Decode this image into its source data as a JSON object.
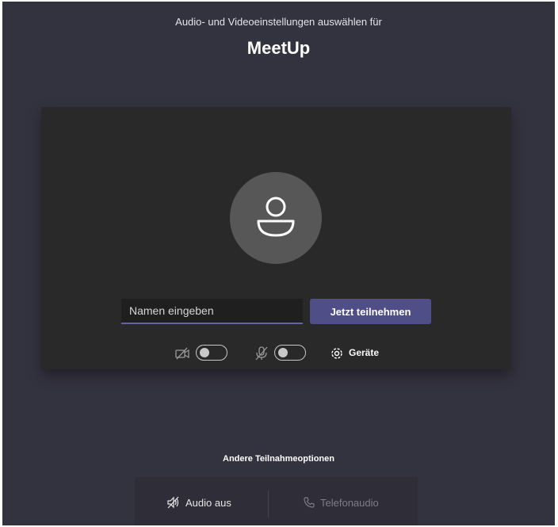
{
  "header": {
    "subtitle": "Audio- und Videoeinstellungen auswählen für",
    "title": "MeetUp"
  },
  "preview": {
    "avatar_icon": "person-icon",
    "name_placeholder": "Namen eingeben",
    "join_label": "Jetzt teilnehmen",
    "camera": {
      "icon": "camera-off-icon",
      "on": false
    },
    "microphone": {
      "icon": "mic-off-icon",
      "on": false
    },
    "devices_label": "Geräte",
    "devices_icon": "gear-icon"
  },
  "other_options": {
    "title": "Andere Teilnahmeoptionen",
    "audio_off_label": "Audio aus",
    "audio_off_icon": "speaker-off-icon",
    "phone_audio_label": "Telefonaudio",
    "phone_audio_icon": "phone-icon"
  },
  "colors": {
    "background": "#33323f",
    "preview_bg": "#292929",
    "accent": "#6264a7",
    "join_button": "#4f4e86"
  }
}
